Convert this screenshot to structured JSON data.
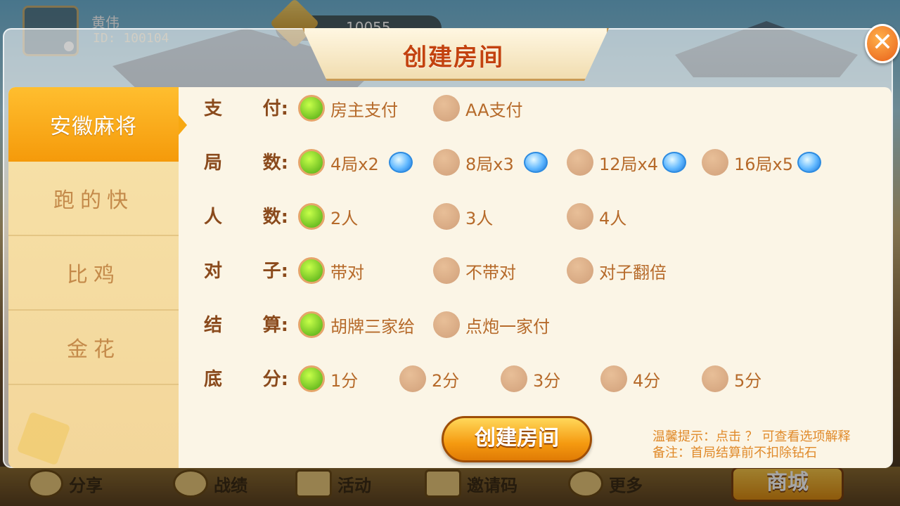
{
  "player": {
    "name": "黄伟",
    "id": "ID: 100104",
    "coins": "10055"
  },
  "bottom_nav": [
    {
      "label": "分享"
    },
    {
      "label": "战绩"
    },
    {
      "label": "活动"
    },
    {
      "label": "邀请码"
    },
    {
      "label": "更多"
    }
  ],
  "shop_label": "商城",
  "modal": {
    "title": "创建房间",
    "close_glyph": "✕",
    "tabs": [
      {
        "label": "安徽麻将",
        "active": true
      },
      {
        "label": "跑的快"
      },
      {
        "label": "比鸡"
      },
      {
        "label": "金花"
      }
    ],
    "rows": [
      {
        "label_a": "支",
        "label_b": "付:",
        "options": [
          {
            "text": "房主支付",
            "selected": true
          },
          {
            "text": "AA支付"
          }
        ]
      },
      {
        "label_a": "局",
        "label_b": "数:",
        "options": [
          {
            "text": "4局x2",
            "selected": true,
            "icon": "diamond-icon"
          },
          {
            "text": "8局x3",
            "icon": "diamond-icon"
          },
          {
            "text": "12局x4",
            "icon": "diamond-icon"
          },
          {
            "text": "16局x5",
            "icon": "diamond-icon"
          }
        ]
      },
      {
        "label_a": "人",
        "label_b": "数:",
        "options": [
          {
            "text": "2人",
            "selected": true
          },
          {
            "text": "3人"
          },
          {
            "text": "4人"
          }
        ]
      },
      {
        "label_a": "对",
        "label_b": "子:",
        "options": [
          {
            "text": "带对",
            "selected": true
          },
          {
            "text": "不带对"
          },
          {
            "text": "对子翻倍"
          }
        ]
      },
      {
        "label_a": "结",
        "label_b": "算:",
        "options": [
          {
            "text": "胡牌三家给",
            "selected": true
          },
          {
            "text": "点炮一家付"
          }
        ]
      },
      {
        "label_a": "底",
        "label_b": "分:",
        "options": [
          {
            "text": "1分",
            "selected": true
          },
          {
            "text": "2分"
          },
          {
            "text": "3分"
          },
          {
            "text": "4分"
          },
          {
            "text": "5分"
          }
        ]
      }
    ],
    "create_button": "创建房间",
    "tip_line1": "温馨提示：点击 ？ 可查看选项解释",
    "tip_line2": "备注：首局结算前不扣除钻石"
  },
  "colors": {
    "selected_radio": "#4aa612",
    "unselected_radio": "#d1a07a",
    "active_tab": "#f59a0a",
    "title": "#c3420f"
  }
}
